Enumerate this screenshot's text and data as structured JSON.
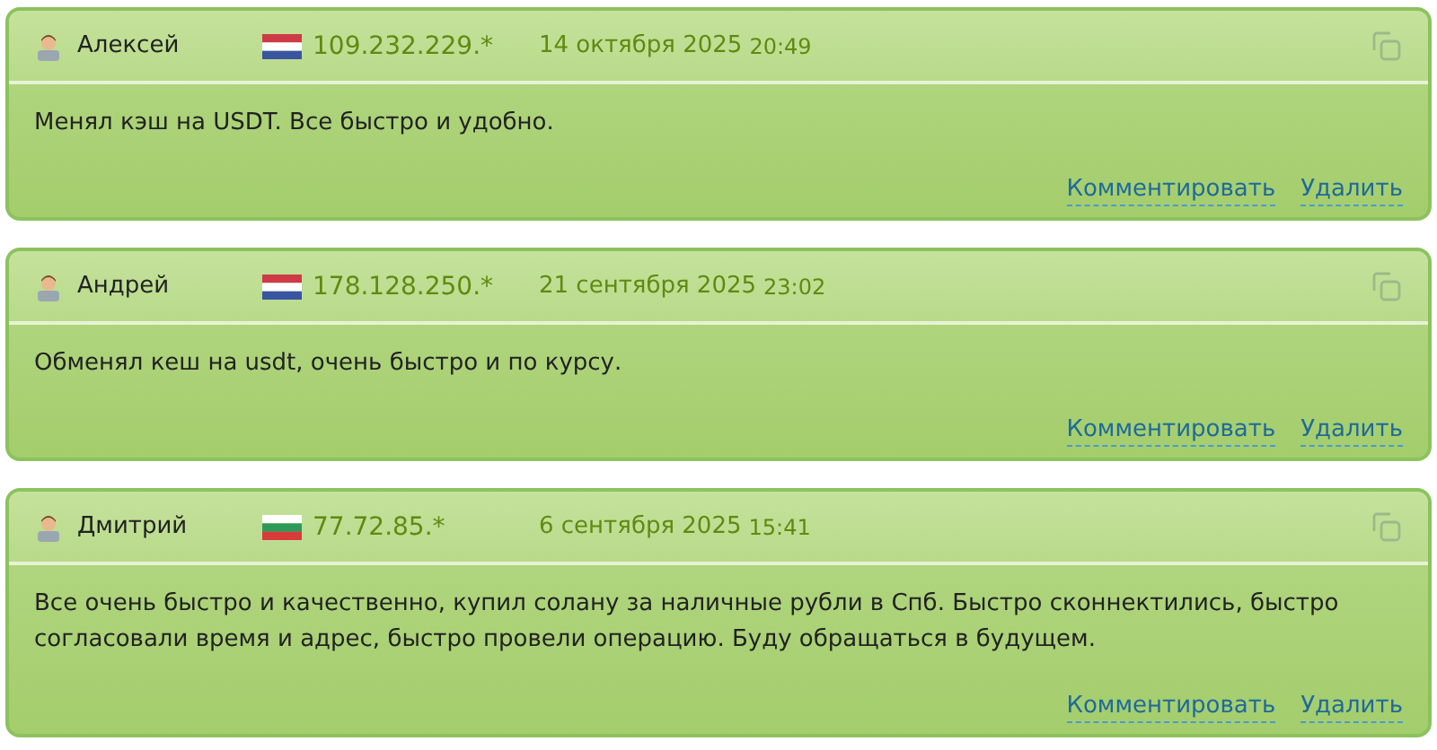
{
  "reviews": [
    {
      "author": "Алексей",
      "flag": [
        {
          "color": "#ce3b47"
        },
        {
          "color": "#ffffff"
        },
        {
          "color": "#3a55a0"
        }
      ],
      "ip": "109.232.229.*",
      "date": "14 октября 2025",
      "time": "20:49",
      "text": "Менял кэш на USDT. Все быстро и удобно.",
      "actions": [
        "Комментировать",
        "Удалить"
      ]
    },
    {
      "author": "Андрей",
      "flag": [
        {
          "color": "#ce3b47"
        },
        {
          "color": "#ffffff"
        },
        {
          "color": "#3a55a0"
        }
      ],
      "ip": "178.128.250.*",
      "date": "21 сентября 2025",
      "time": "23:02",
      "text": "Обменял кеш на usdt, очень быстро и по курсу.",
      "actions": [
        "Комментировать",
        "Удалить"
      ]
    },
    {
      "author": "Дмитрий",
      "flag": [
        {
          "color": "#ffffff"
        },
        {
          "color": "#2e9a5a"
        },
        {
          "color": "#d93b3b"
        }
      ],
      "ip": "77.72.85.*",
      "date": "6 сентября 2025",
      "time": "15:41",
      "text": "Все очень быстро и качественно, купил солану за наличные рубли в Спб. Быстро сконнектились, быстро согласовали время и адрес, быстро провели операцию. Буду обращаться в будущем.",
      "actions": [
        "Комментировать",
        "Удалить"
      ]
    }
  ]
}
